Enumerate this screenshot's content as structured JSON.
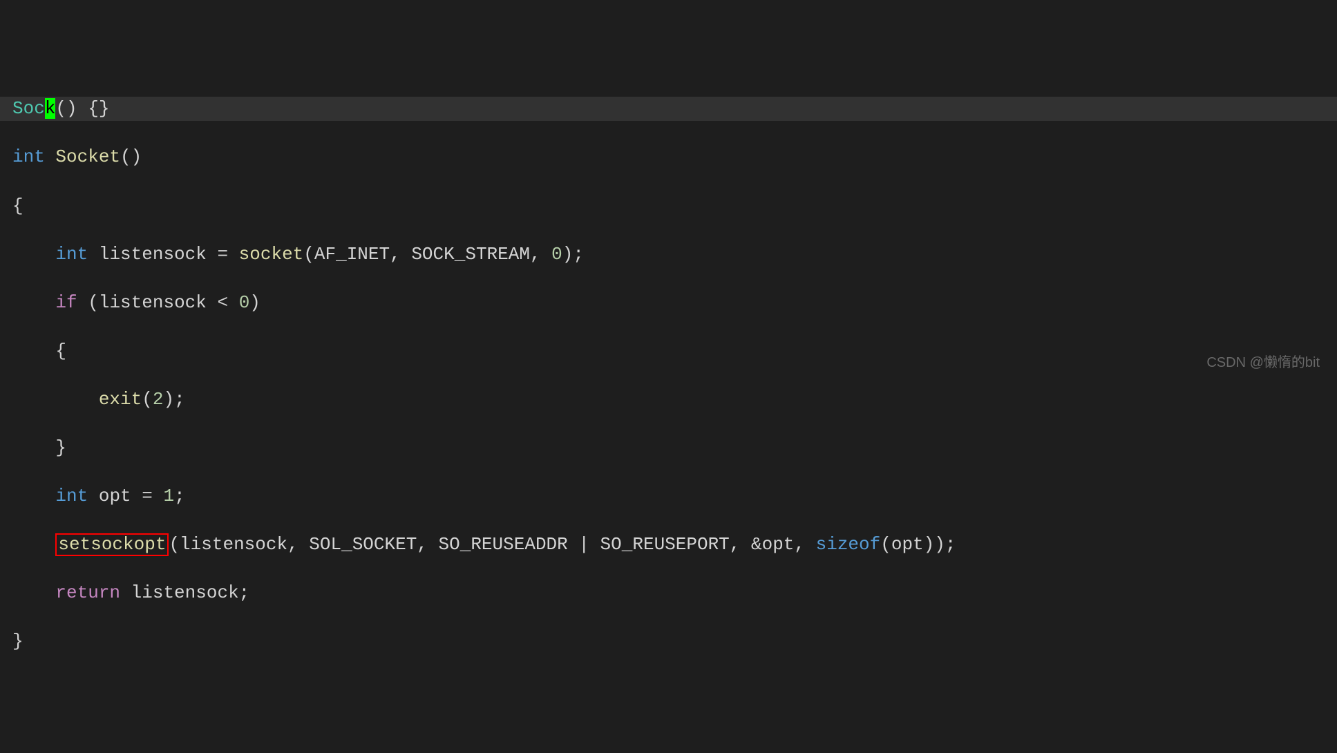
{
  "top_line": {
    "soc": "Soc",
    "k": "k",
    "rest": "() {}"
  },
  "code": {
    "l1_int": "int",
    "l1_socket": " Socket",
    "l1_paren": "()",
    "l2": "{",
    "l3_indent": "    ",
    "l3_int": "int",
    "l3_listen": " listensock = ",
    "l3_socket": "socket",
    "l3_args": "(AF_INET, SOCK_STREAM, ",
    "l3_zero": "0",
    "l3_end": ");",
    "l4_indent": "    ",
    "l4_if": "if",
    "l4_cond": " (listensock < ",
    "l4_zero": "0",
    "l4_end": ")",
    "l5": "    {",
    "l6_indent": "        ",
    "l6_exit": "exit",
    "l6_open": "(",
    "l6_two": "2",
    "l6_end": ");",
    "l7": "    }",
    "l8_indent": "    ",
    "l8_int": "int",
    "l8_opt": " opt = ",
    "l8_one": "1",
    "l8_end": ";",
    "l9_indent": "    ",
    "l9_setsockopt": "setsockopt",
    "l9_args": "(listensock, SOL_SOCKET, SO_REUSEADDR | SO_REUSEPORT, &opt, ",
    "l9_sizeof": "sizeof",
    "l9_end": "(opt));",
    "l10_indent": "    ",
    "l10_return": "return",
    "l10_listen": " listensock;",
    "l11": "}"
  },
  "watermark": "CSDN @懒惰的bit"
}
